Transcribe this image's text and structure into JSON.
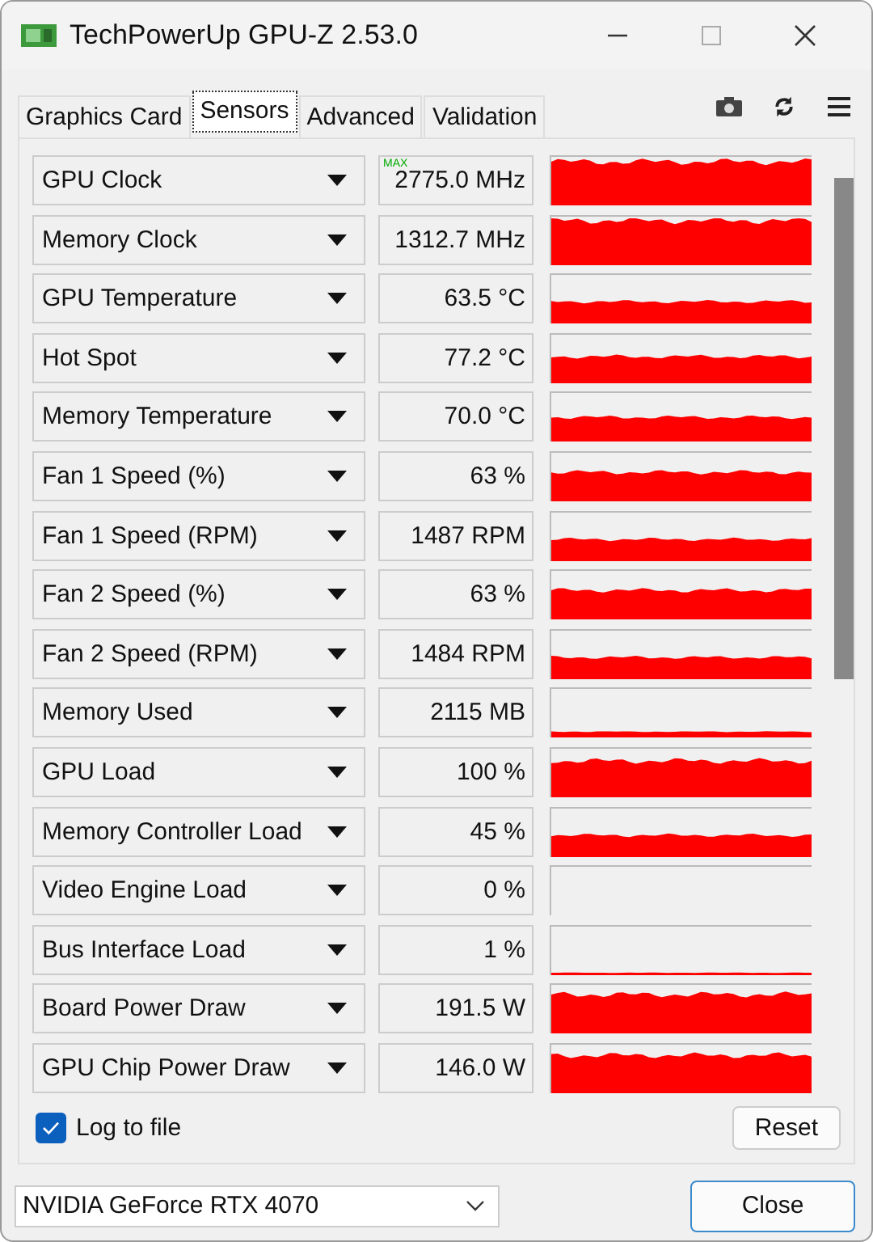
{
  "window": {
    "title": "TechPowerUp GPU-Z 2.53.0"
  },
  "tabs": [
    {
      "label": "Graphics Card",
      "selected": false
    },
    {
      "label": "Sensors",
      "selected": true
    },
    {
      "label": "Advanced",
      "selected": false
    },
    {
      "label": "Validation",
      "selected": false
    }
  ],
  "sensors": [
    {
      "name": "GPU Clock",
      "value": "2775.0 MHz",
      "badge": "MAX"
    },
    {
      "name": "Memory Clock",
      "value": "1312.7 MHz"
    },
    {
      "name": "GPU Temperature",
      "value": "63.5 °C"
    },
    {
      "name": "Hot Spot",
      "value": "77.2 °C"
    },
    {
      "name": "Memory Temperature",
      "value": "70.0 °C"
    },
    {
      "name": "Fan 1 Speed (%)",
      "value": "63 %"
    },
    {
      "name": "Fan 1 Speed (RPM)",
      "value": "1487 RPM"
    },
    {
      "name": "Fan 2 Speed (%)",
      "value": "63 %"
    },
    {
      "name": "Fan 2 Speed (RPM)",
      "value": "1484 RPM"
    },
    {
      "name": "Memory Used",
      "value": "2115 MB"
    },
    {
      "name": "GPU Load",
      "value": "100 %"
    },
    {
      "name": "Memory Controller Load",
      "value": "45 %"
    },
    {
      "name": "Video Engine Load",
      "value": "0 %"
    },
    {
      "name": "Bus Interface Load",
      "value": "1 %"
    },
    {
      "name": "Board Power Draw",
      "value": "191.5 W"
    },
    {
      "name": "GPU Chip Power Draw",
      "value": "146.0 W"
    }
  ],
  "log_to_file": {
    "label": "Log to file",
    "checked": true
  },
  "reset_button": "Reset",
  "device_select": "NVIDIA GeForce RTX 4070",
  "close_button": "Close"
}
